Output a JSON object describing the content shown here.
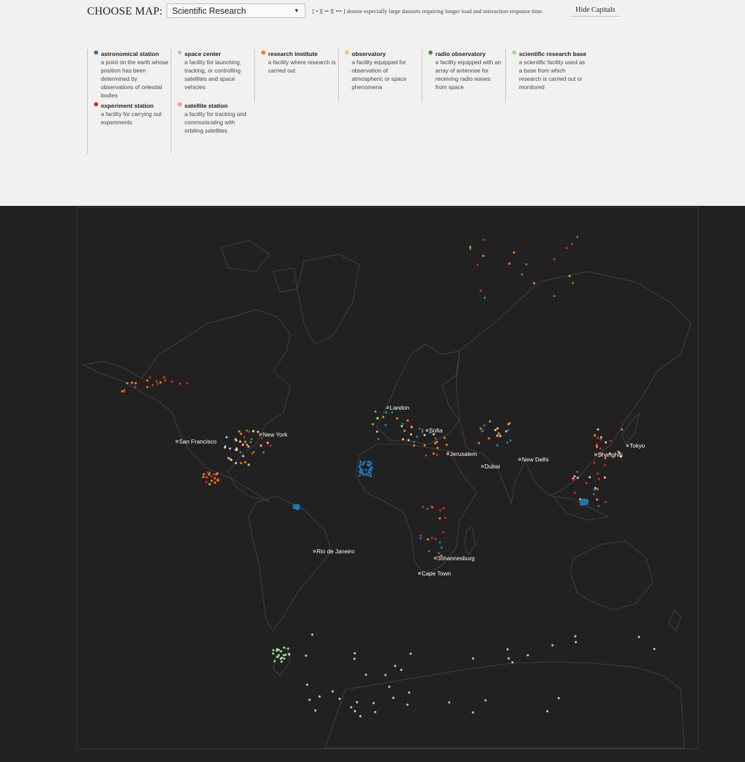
{
  "header": {
    "choose_label": "CHOOSE MAP:",
    "selected_map": "Scientific Research",
    "note": "[ • ][ •• ][ ••• ] denote especially large datasets requiring longer load and interaction response time.",
    "hide_capitals": "Hide Capitals"
  },
  "legend": [
    {
      "name": "astronomical station",
      "desc": "a point on the earth whose position has been determined by observations of celestial bodies",
      "color": "#1f77b4"
    },
    {
      "name": "experiment station",
      "desc": "a facility for carrying out experiments",
      "color": "#d62728"
    },
    {
      "name": "space center",
      "desc": "a facility for launching, tracking, or controlling satellites and space vehicles",
      "color": "#aec7e8"
    },
    {
      "name": "satellite station",
      "desc": "a facility for tracking and communicating with orbiting satellites",
      "color": "#ff9896"
    },
    {
      "name": "research institute",
      "desc": "a facility where research is carried out",
      "color": "#ff7f0e"
    },
    {
      "name": "observatory",
      "desc": "a facility equipped for observation of atmospheric or space phenomena",
      "color": "#ffbb78"
    },
    {
      "name": "radio observatory",
      "desc": "a facility equipped with an array of antennae for receiving radio waves from space",
      "color": "#2ca02c"
    },
    {
      "name": "scientific research base",
      "desc": "a scientific facility used as a base from which research is carried out or monitored",
      "color": "#98df8a"
    }
  ],
  "map": {
    "background": "#212121",
    "capitals": [
      {
        "name": "London"
      },
      {
        "name": "Sofia"
      },
      {
        "name": "New York"
      },
      {
        "name": "San Francisco"
      },
      {
        "name": "Jerusalem"
      },
      {
        "name": "Dubai"
      },
      {
        "name": "New Delhi"
      },
      {
        "name": "Shanghai"
      },
      {
        "name": "Tokyo"
      },
      {
        "name": "Rio de Janeiro"
      },
      {
        "name": "Johannesburg"
      },
      {
        "name": "Cape Town"
      }
    ]
  }
}
